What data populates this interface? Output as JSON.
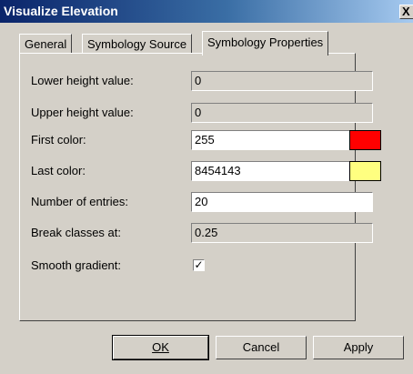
{
  "window": {
    "title": "Visualize Elevation",
    "close_glyph": "X"
  },
  "tabs": [
    {
      "label": "General",
      "active": false
    },
    {
      "label": "Symbology Source",
      "active": false
    },
    {
      "label": "Symbology Properties",
      "active": true
    }
  ],
  "fields": {
    "lower_height": {
      "label": "Lower height value:",
      "value": "0",
      "enabled": false
    },
    "upper_height": {
      "label": "Upper height value:",
      "value": "0",
      "enabled": false
    },
    "first_color": {
      "label": "First color:",
      "value": "255",
      "enabled": true,
      "swatch_color": "#ff0000"
    },
    "last_color": {
      "label": "Last color:",
      "value": "8454143",
      "enabled": true,
      "swatch_color": "#ffff80"
    },
    "num_entries": {
      "label": "Number of entries:",
      "value": "20",
      "enabled": true
    },
    "break_classes": {
      "label": "Break classes at:",
      "value": "0.25",
      "enabled": false
    },
    "smooth_gradient": {
      "label": "Smooth gradient:",
      "checked": true,
      "check_glyph": "✓"
    }
  },
  "buttons": {
    "ok": "OK",
    "cancel": "Cancel",
    "apply": "Apply"
  }
}
